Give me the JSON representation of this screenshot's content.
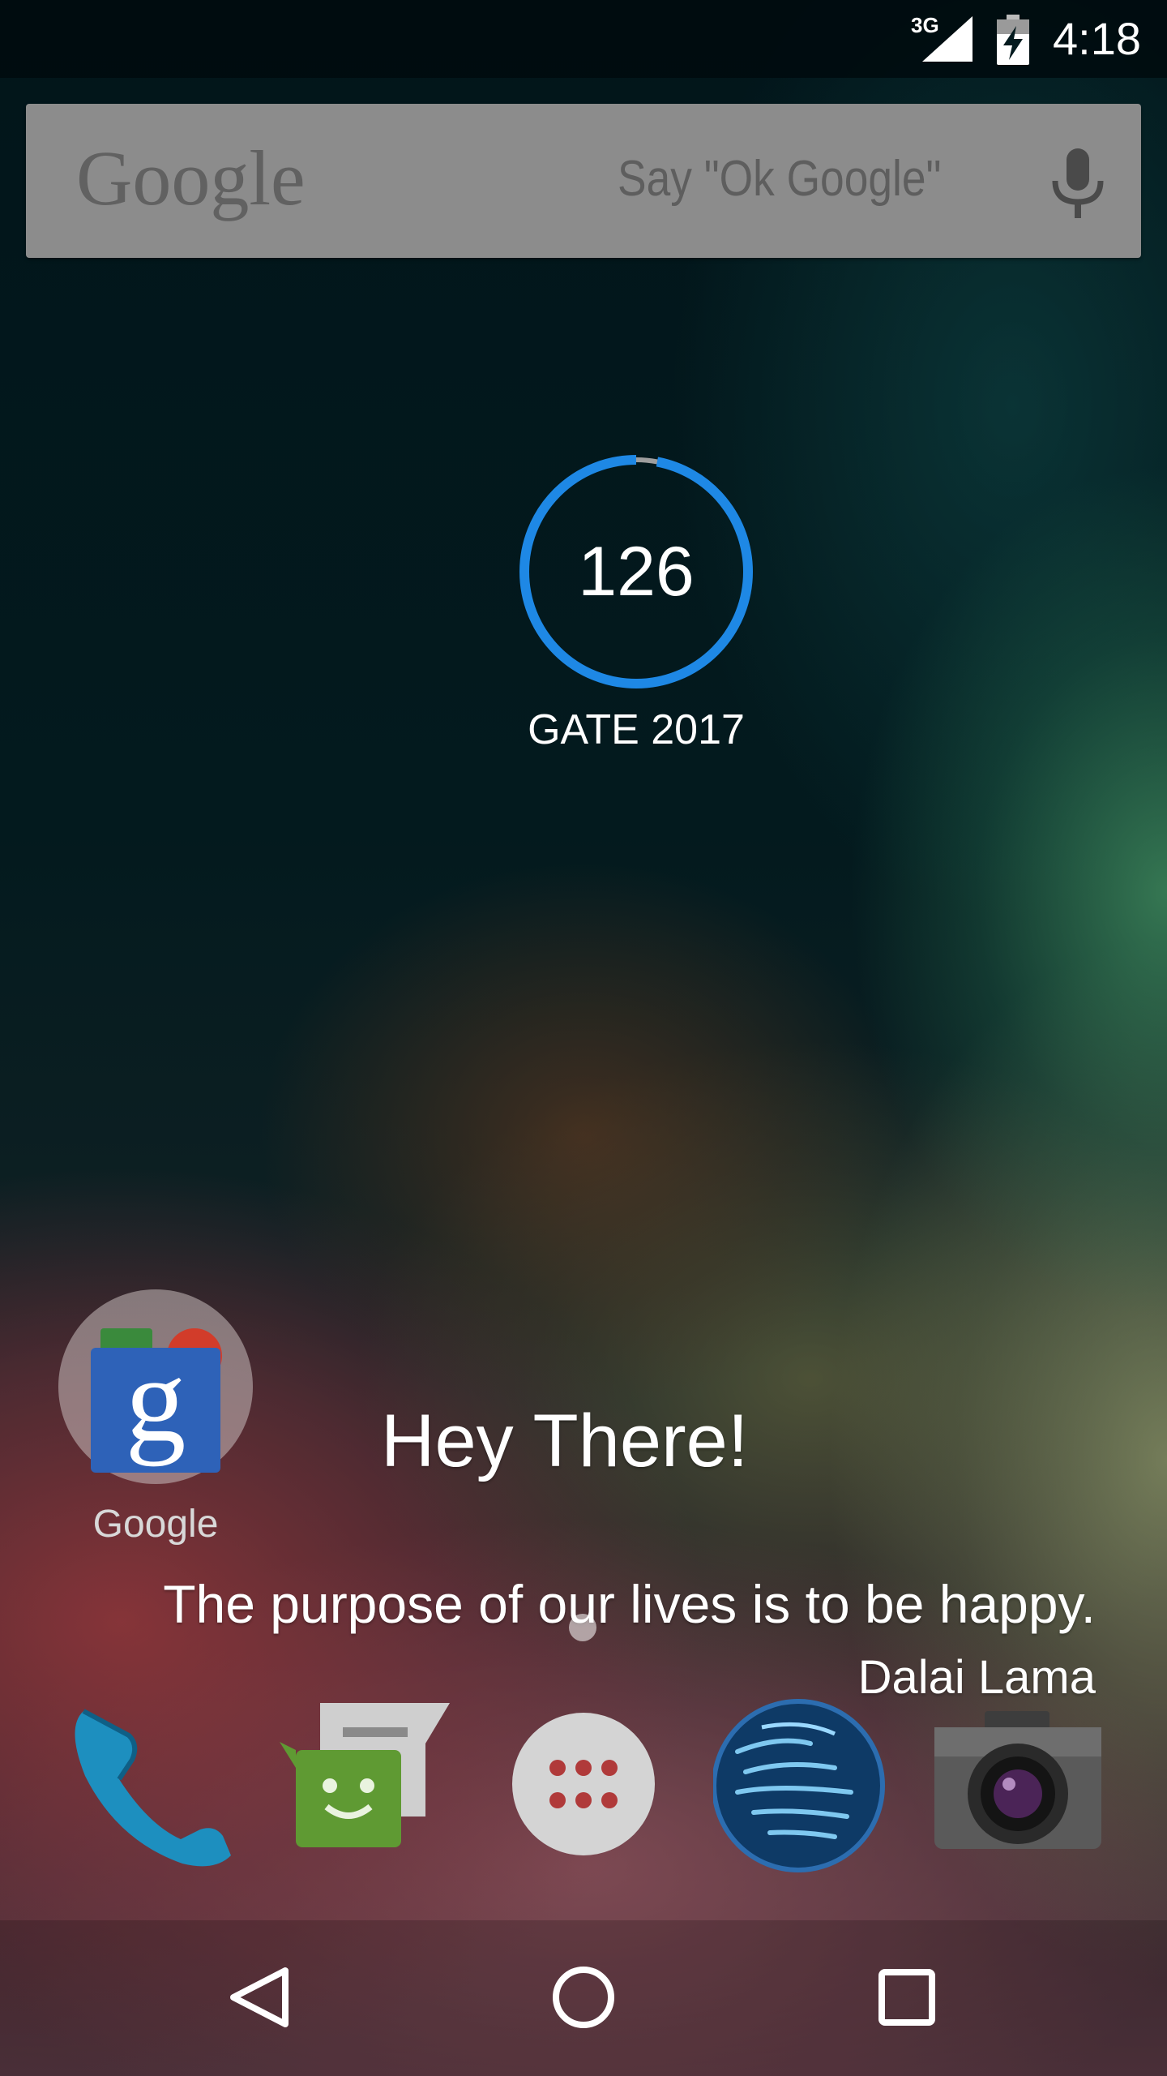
{
  "status_bar": {
    "network_type": "3G",
    "time": "4:18",
    "icons": [
      "signal-icon",
      "battery-charging-icon"
    ]
  },
  "search_widget": {
    "logo": "Google",
    "hint": "Say \"Ok Google\"",
    "icon": "mic-icon"
  },
  "countdown_widget": {
    "value": "126",
    "label": "GATE 2017",
    "progress_fraction": 0.97,
    "colors": {
      "progress": "#1e88e5",
      "track": "#9e9e9e"
    }
  },
  "home_folder": {
    "label": "Google",
    "icon": "google-folder-icon"
  },
  "quote_widget": {
    "greeting": "Hey There!",
    "quote": "The purpose of our lives is to be happy.",
    "author": "Dalai Lama"
  },
  "dock": {
    "items": [
      {
        "app": "phone",
        "icon": "phone-icon"
      },
      {
        "app": "messages",
        "icon": "messages-icon"
      },
      {
        "app": "all-apps",
        "icon": "app-drawer-icon"
      },
      {
        "app": "browser",
        "icon": "globe-icon"
      },
      {
        "app": "camera",
        "icon": "camera-icon"
      }
    ]
  },
  "nav_bar": {
    "icons": [
      "back-icon",
      "home-icon",
      "recents-icon"
    ]
  }
}
